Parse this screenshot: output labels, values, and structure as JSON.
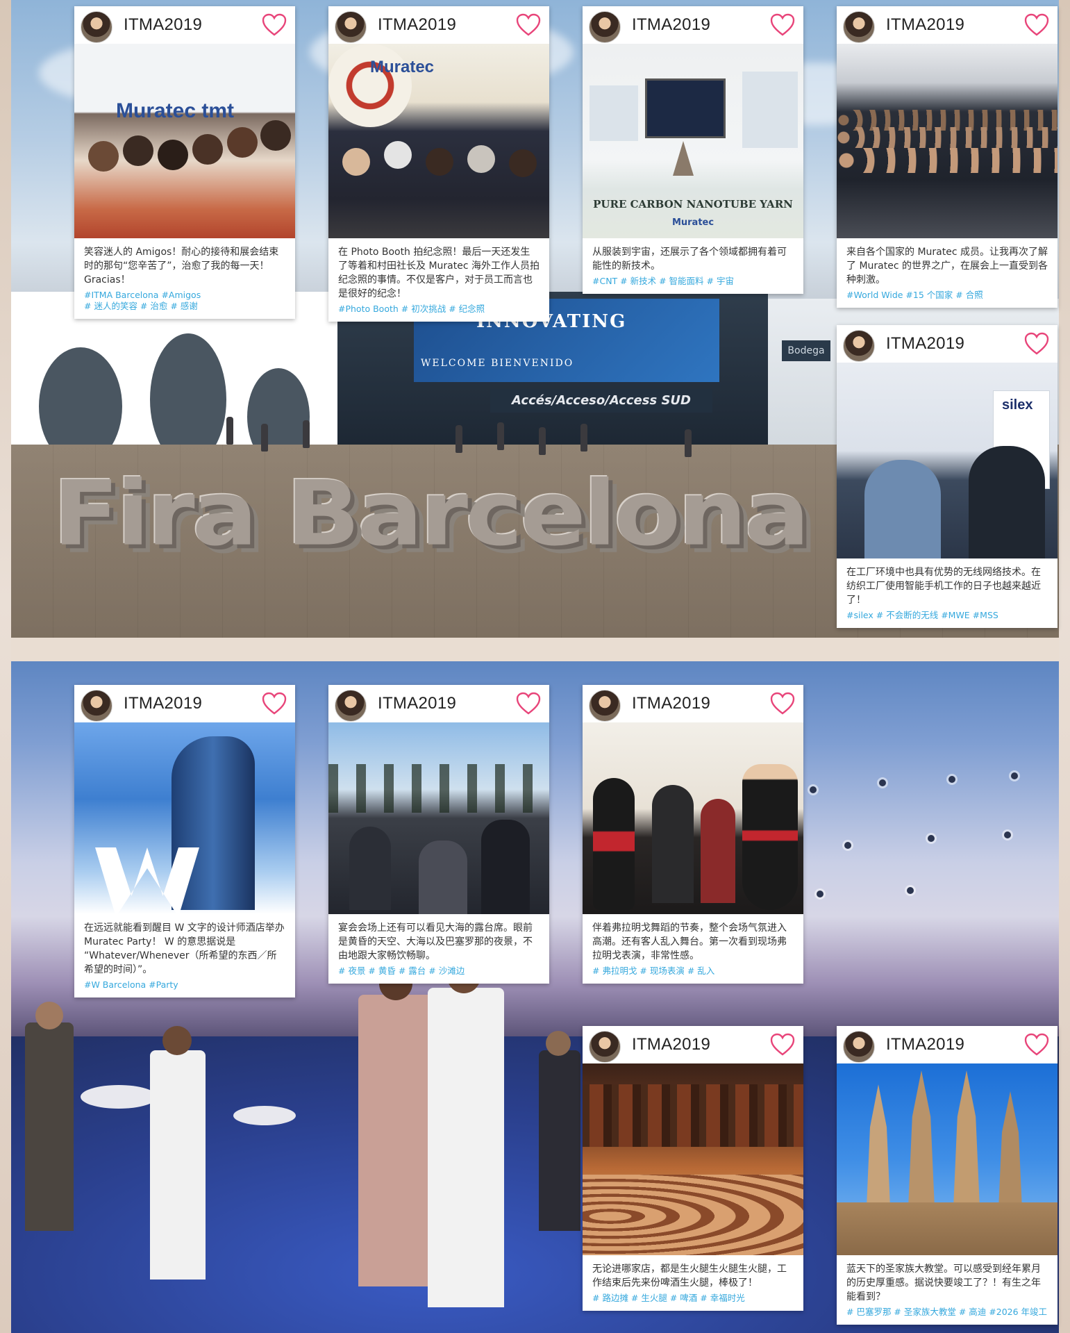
{
  "account_name": "ITMA2019",
  "accent_color": "#e8457a",
  "tag_color": "#35a8dd",
  "scene_top": {
    "sign_letters": "Fira Barcelona",
    "banner_title": "INNOVATING",
    "banner_welcome": "WELCOME BIENVENIDO",
    "access_sign": "Accés/Acceso/Access SUD",
    "bodega_sign": "Bodega"
  },
  "cards": [
    {
      "photo_text": "Muratec tmt",
      "caption": "笑容迷人的 Amigos！耐心的接待和展会结束时的那句“您辛苦了”，治愈了我的每一天！ Gracias！",
      "tags": "#ITMA Barcelona #Amigos\n# 迷人的笑容 # 治愈 # 感谢"
    },
    {
      "photo_text": "Muratec",
      "caption": "在 Photo Booth 拍纪念照！最后一天还发生了等着和村田社长及 Muratec 海外工作人员拍纪念照的事情。不仅是客户，对于员工而言也是很好的纪念！",
      "tags": "#Photo Booth # 初次挑战 # 纪念照"
    },
    {
      "photo_text": "PURE CARBON NANOTUBE YARN",
      "photo_text2": "Muratec",
      "caption": "从服装到宇宙，还展示了各个领域都拥有着可能性的新技术。",
      "tags": "#CNT # 新技术 # 智能面料 # 宇宙"
    },
    {
      "caption": "来自各个国家的 Muratec 成员。让我再次了解了 Muratec 的世界之广，在展会上一直受到各种刺激。",
      "tags": "#World Wide #15 个国家 # 合照"
    },
    {
      "photo_text": "silex",
      "caption": "在工厂环境中也具有优势的无线网络技术。在纺织工厂使用智能手机工作的日子也越来越近了！",
      "tags": "#silex # 不会断的无线 #MWE #MSS"
    },
    {
      "caption": "在远远就能看到醒目 W 文字的设计师酒店举办 Muratec Party！ W 的意思据说是 “Whatever/Whenever（所希望的东西／所希望的时间）”。",
      "tags": "#W Barcelona #Party"
    },
    {
      "caption": "宴会会场上还有可以看见大海的露台席。眼前是黄昏的天空、大海以及巴塞罗那的夜景，不由地跟大家畅饮畅聊。",
      "tags": "# 夜景 # 黄昏 # 露台 # 沙滩边"
    },
    {
      "caption": "伴着弗拉明戈舞蹈的节奏，整个会场气氛进入高潮。还有客人乱入舞台。第一次看到现场弗拉明戈表演，非常性感。",
      "tags": "# 弗拉明戈 # 现场表演 # 乱入"
    },
    {
      "caption": "无论进哪家店，都是生火腿生火腿生火腿，工作结束后先来份啤酒生火腿，棒极了！",
      "tags": "# 路边摊 # 生火腿 # 啤酒 # 幸福时光"
    },
    {
      "caption": "蓝天下的圣家族大教堂。可以感受到经年累月的历史厚重感。据说快要竣工了？！有生之年能看到？",
      "tags": "# 巴塞罗那 # 圣家族大教堂 # 高迪 #2026 年竣工"
    }
  ]
}
